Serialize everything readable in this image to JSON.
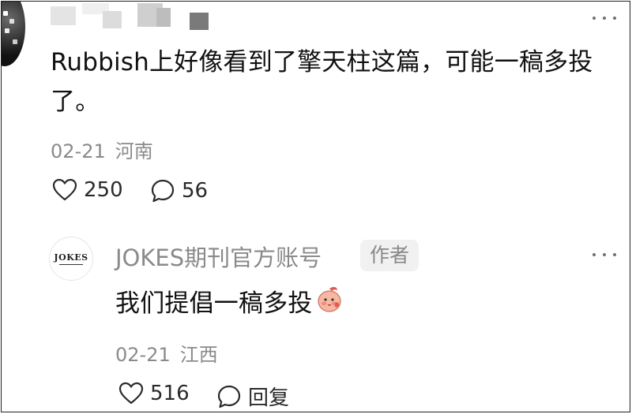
{
  "comment": {
    "text_line1": "Rubbish上好像看到了擎天柱这篇，可能一稿多投",
    "text_line2": "了。",
    "date": "02-21",
    "region": "河南",
    "like_count": "250",
    "reply_count": "56"
  },
  "reply": {
    "author": "JOKES期刊官方账号",
    "author_badge": "作者",
    "avatar_logo_text": "JOKES",
    "text": "我们提倡一稿多投",
    "date": "02-21",
    "region": "江西",
    "like_count": "516",
    "reply_label": "回复"
  },
  "icons": {
    "like": "heart-outline-icon",
    "comment": "speech-bubble-icon",
    "more": "more-dots-icon",
    "emoji": "peach-face-emoji"
  },
  "colors": {
    "text_primary": "#111111",
    "text_secondary": "#8a8a8a",
    "badge_bg": "#f1f1f1"
  }
}
